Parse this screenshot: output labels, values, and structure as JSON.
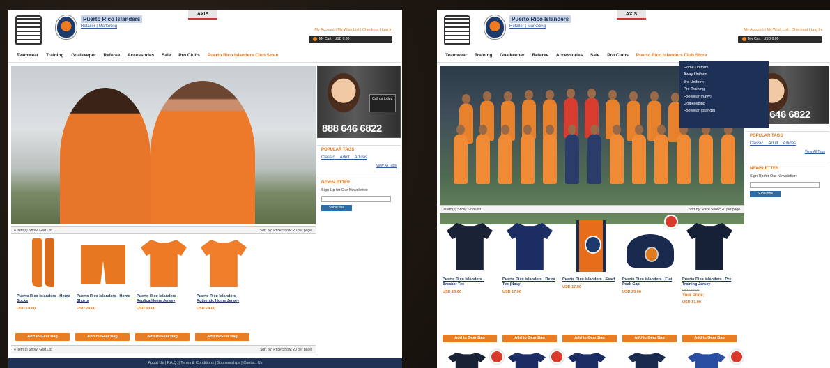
{
  "left_page": {
    "site_title": "Puerto Rico Islanders",
    "header_links": "Retailer | Marketing",
    "brand": "AXIS",
    "account_links": "My Account | My Wish List | Checkout | Log In",
    "cart": "My Cart",
    "cart_total": "USD 0.00",
    "nav": [
      "Teamwear",
      "Training",
      "Goalkeeper",
      "Referee",
      "Accessories",
      "Sale",
      "Pro Clubs",
      "Puerto Rico Islanders Club Store"
    ],
    "phone_number": "888 646 6822",
    "support_box": "Call us today",
    "popular_tags_title": "POPULAR TAGS",
    "tags": "Classic Adult Adidas",
    "view_all_tags": "View All Tags",
    "newsletter_title": "NEWSLETTER",
    "newsletter_text": "Sign Up for Our Newsletter:",
    "subscribe": "Subscribe",
    "pager_left": "4 Item(s)  Show: Grid List",
    "pager_right": "Sort By: Price  Show: 20 per page",
    "products": [
      {
        "name": "Puerto Rico Islanders - Home Socks",
        "price": "USD 18.00"
      },
      {
        "name": "Puerto Rico Islanders - Home Shorts",
        "price": "USD 28.00"
      },
      {
        "name": "Puerto Rico Islanders - Replica Home Jersey",
        "price": "USD 60.00"
      },
      {
        "name": "Puerto Rico Islanders - Authentic Home Jersey",
        "price": "USD 74.00"
      }
    ],
    "add_to_bag": "Add to Gear Bag",
    "footer": "About Us | F.A.Q. | Terms & Conditions | Sponsorships | Contact Us"
  },
  "right_page": {
    "site_title": "Puerto Rico Islanders",
    "header_links": "Retailer | Marketing",
    "brand": "AXIS",
    "account_links": "My Account | My Wish List | Checkout | Log In",
    "cart": "My Cart",
    "cart_total": "USD 0.00",
    "nav": [
      "Teamwear",
      "Training",
      "Goalkeeper",
      "Referee",
      "Accessories",
      "Sale",
      "Pro Clubs",
      "Puerto Rico Islanders Club Store"
    ],
    "dropdown": [
      "Home Uniform",
      "Away Uniform",
      "3rd Uniform",
      "Pre-Training",
      "Footwear (navy)",
      "Goalkeeping",
      "Footwear (orange)"
    ],
    "phone_number": "888 646 6822",
    "popular_tags_title": "POPULAR TAGS",
    "tags": "Classic Adult Adidas",
    "view_all_tags": "View All Tags",
    "newsletter_title": "NEWSLETTER",
    "newsletter_text": "Sign Up for Our Newsletter:",
    "subscribe": "Subscribe",
    "pager_left": "9 Item(s)  Show: Grid List",
    "pager_right": "Sort By: Price  Show: 20 per page",
    "products": [
      {
        "name": "Puerto Rico Islanders - Breaker Tee",
        "price": "USD 10.00"
      },
      {
        "name": "Puerto Rico Islanders - Retro Tee (Navy)",
        "price": "USD 17.00"
      },
      {
        "name": "Puerto Rico Islanders - Scarf",
        "price": "USD 17.00"
      },
      {
        "name": "Puerto Rico Islanders - Flat Peak Cap",
        "price": "USD 25.00"
      },
      {
        "name": "Puerto Rico Islanders - Pre Training Jersey",
        "regular": "USD 40.00",
        "your_price_label": "Your Price:",
        "price": "USD 17.00"
      }
    ],
    "add_to_bag": "Add to Gear Bag"
  },
  "colors": {
    "accent": "#e77d25",
    "navy": "#1d3157",
    "link": "#2a56a3"
  }
}
